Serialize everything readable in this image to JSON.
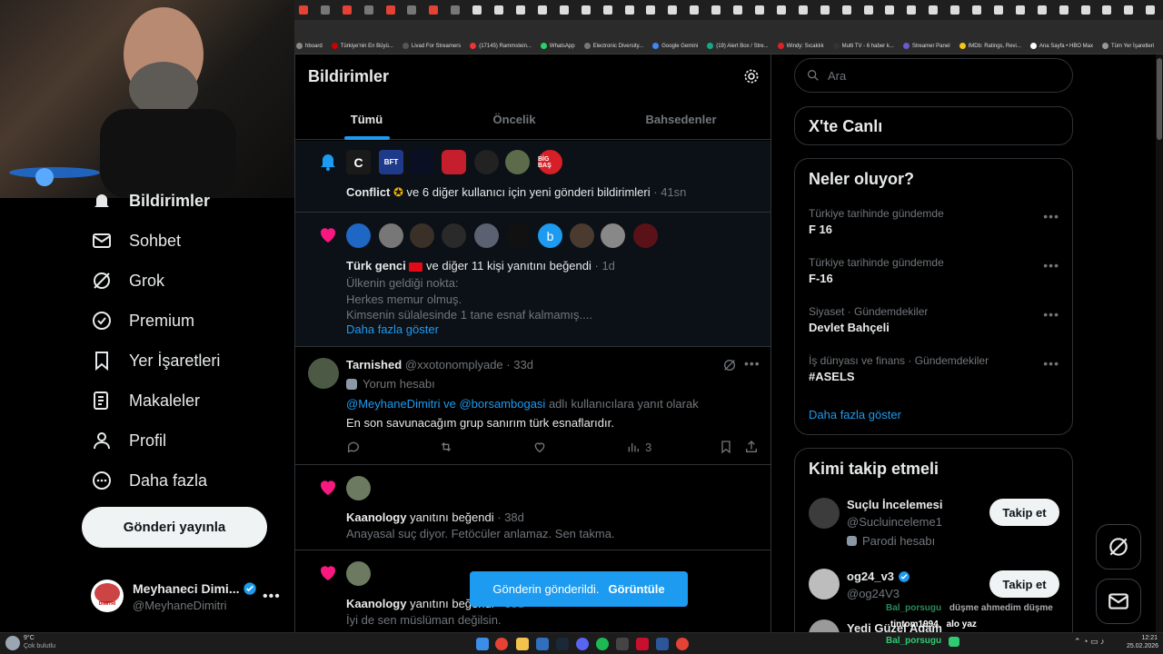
{
  "colors": {
    "accent": "#1d9bf0",
    "like": "#f91880",
    "bg": "#000000",
    "border": "#2f3336",
    "muted": "#71767b"
  },
  "browser": {
    "tab_count": 40,
    "bookmarks": [
      "hboard",
      "Türkiye'nin En Büyü...",
      "Livad For Streamers",
      "(17145) Rammstein...",
      "WhatsApp",
      "Electronic Diversity...",
      "Google Gemini",
      "(19) Alert Box / Stre...",
      "Windy: Sıcaklık",
      "Multi TV - 6 haber k...",
      "Streamer Panel",
      "IMDb: Ratings, Revi...",
      "Ana Sayfa • HBO Max",
      "Tüm Yer İşaretleri"
    ]
  },
  "nav": {
    "items": [
      {
        "label": "Bildirimler",
        "icon": "bell-icon"
      },
      {
        "label": "Sohbet",
        "icon": "mail-icon"
      },
      {
        "label": "Grok",
        "icon": "grok-icon"
      },
      {
        "label": "Premium",
        "icon": "verified-badge-icon"
      },
      {
        "label": "Yer İşaretleri",
        "icon": "bookmark-icon"
      },
      {
        "label": "Makaleler",
        "icon": "article-icon"
      },
      {
        "label": "Profil",
        "icon": "person-icon"
      },
      {
        "label": "Daha fazla",
        "icon": "more-circle-icon"
      }
    ],
    "post_button": "Gönderi yayınla",
    "account": {
      "name": "Meyhaneci Dimi...",
      "handle": "@MeyhaneDimitri",
      "avatar_text": "DIMITRI"
    }
  },
  "header": {
    "title": "Bildirimler",
    "tabs": [
      "Tümü",
      "Öncelik",
      "Bahsedenler"
    ],
    "active_tab": "Tümü"
  },
  "notifications": {
    "n1": {
      "actor": "Conflict",
      "text": "ve 6 diğer kullanıcı için yeni gönderi bildirimleri",
      "time": "· 41sn",
      "badges": [
        "C",
        "BFT",
        "",
        "",
        "",
        "",
        "BİG BAŞ"
      ]
    },
    "n2": {
      "actor": "Türk genci",
      "text": "ve diğer 11 kişi yanıtını beğendi",
      "time": "· 1d",
      "lines": [
        "Ülkenin geldiği nokta:",
        "Herkes memur olmuş.",
        "Kimsenin sülalesinde 1 tane esnaf kalmamış...."
      ],
      "more": "Daha fazla göster",
      "b_letter": "b"
    },
    "n3": {
      "name": "Tarnished",
      "handle": "@xxotonomplyade",
      "time": "· 33d",
      "label": "Yorum hesabı",
      "mention1": "@MeyhaneDimitri",
      "and": " ve ",
      "mention2": "@borsambogasi",
      "reply_to": " adlı kullanıcılara yanıt olarak",
      "text": "En son savunacağım grup sanırım türk esnaflarıdır.",
      "views": "3"
    },
    "n4": {
      "actor": "Kaanology",
      "text": "yanıtını beğendi",
      "time": "· 38d",
      "body": "Anayasal suç diyor. Fetöcüler anlamaz. Sen takma."
    },
    "n5": {
      "actor": "Kaanology",
      "text": "yanıtını beğendi",
      "time": "· 38d",
      "body": "İyi de sen müslüman değilsin."
    }
  },
  "toast": {
    "text": "Gönderin gönderildi.",
    "action": "Görüntüle"
  },
  "sidebar": {
    "search_placeholder": "Ara",
    "live_title": "X'te Canlı",
    "trends_title": "Neler oluyor?",
    "trends": [
      {
        "cat": "Türkiye tarihinde gündemde",
        "name": "F 16"
      },
      {
        "cat": "Türkiye tarihinde gündemde",
        "name": "F-16"
      },
      {
        "cat": "Siyaset · Gündemdekiler",
        "name": "Devlet Bahçeli"
      },
      {
        "cat": "İş dünyası ve finans · Gündemdekiler",
        "name": "#ASELS"
      }
    ],
    "trends_more": "Daha fazla göster",
    "follow_title": "Kimi takip etmeli",
    "who_to_follow": [
      {
        "name": "Suçlu İncelemesi",
        "handle": "@Sucluinceleme1",
        "tag": "Parodi hesabı",
        "button": "Takip et"
      },
      {
        "name": "og24_v3",
        "handle": "@og24V3",
        "tag": "",
        "button": "Takip et"
      },
      {
        "name": "Yedi Güzel Adam",
        "handle": "",
        "tag": "",
        "button": ""
      }
    ]
  },
  "chat_overlay": [
    {
      "user": "Bal_porsugu",
      "msg": "düşme ahmedim düşme"
    },
    {
      "user": "tintom1994",
      "msg": "alo yaz"
    },
    {
      "user": "Bal_porsugu",
      "msg": ""
    }
  ],
  "taskbar": {
    "weather_temp": "9°C",
    "weather_text": "Çok bulutlu",
    "time": "12:21",
    "date": "25.02.2026"
  }
}
